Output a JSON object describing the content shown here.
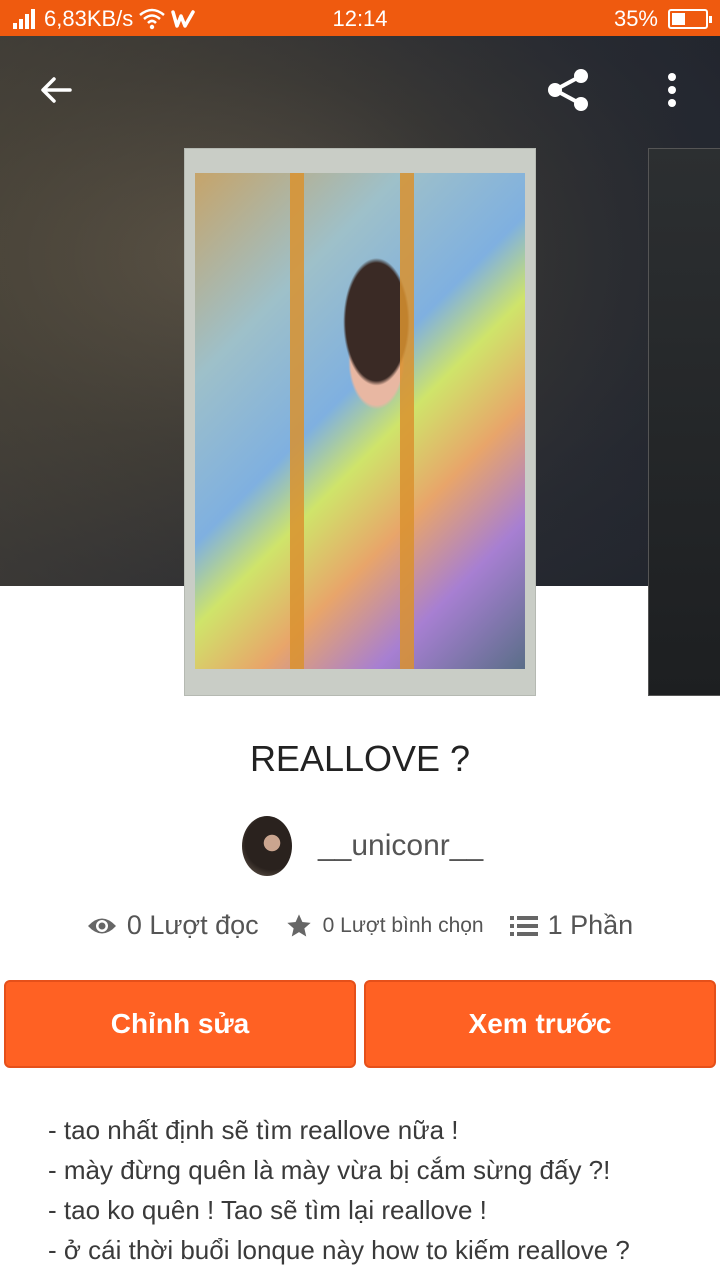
{
  "status_bar": {
    "network_speed": "6,83KB/s",
    "time": "12:14",
    "battery_percent": "35%",
    "battery_level": 0.35,
    "icons": [
      "signal-icon",
      "wifi-icon",
      "wattpad-icon",
      "battery-icon"
    ]
  },
  "toolbar": {
    "back_icon": "back-arrow-icon",
    "share_icon": "share-icon",
    "more_icon": "more-vertical-icon"
  },
  "story": {
    "title": "REALLOVE ?",
    "author": "__uniconr__"
  },
  "stats": {
    "reads": "0 Lượt đọc",
    "votes": "0 Lượt bình chọn",
    "parts": "1 Phần"
  },
  "actions": {
    "edit_label": "Chỉnh sửa",
    "preview_label": "Xem trước"
  },
  "description": {
    "lines": [
      "- tao nhất định sẽ tìm reallove nữa !",
      "- mày đừng quên là mày vừa bị cắm sừng đấy ?!",
      "- tao ko quên ! Tao sẽ tìm lại reallove !",
      "- ở cái thời buổi lonque này how to kiếm reallove ?"
    ]
  },
  "colors": {
    "accent": "#ff6123",
    "status_bar": "#ef5a0f"
  }
}
